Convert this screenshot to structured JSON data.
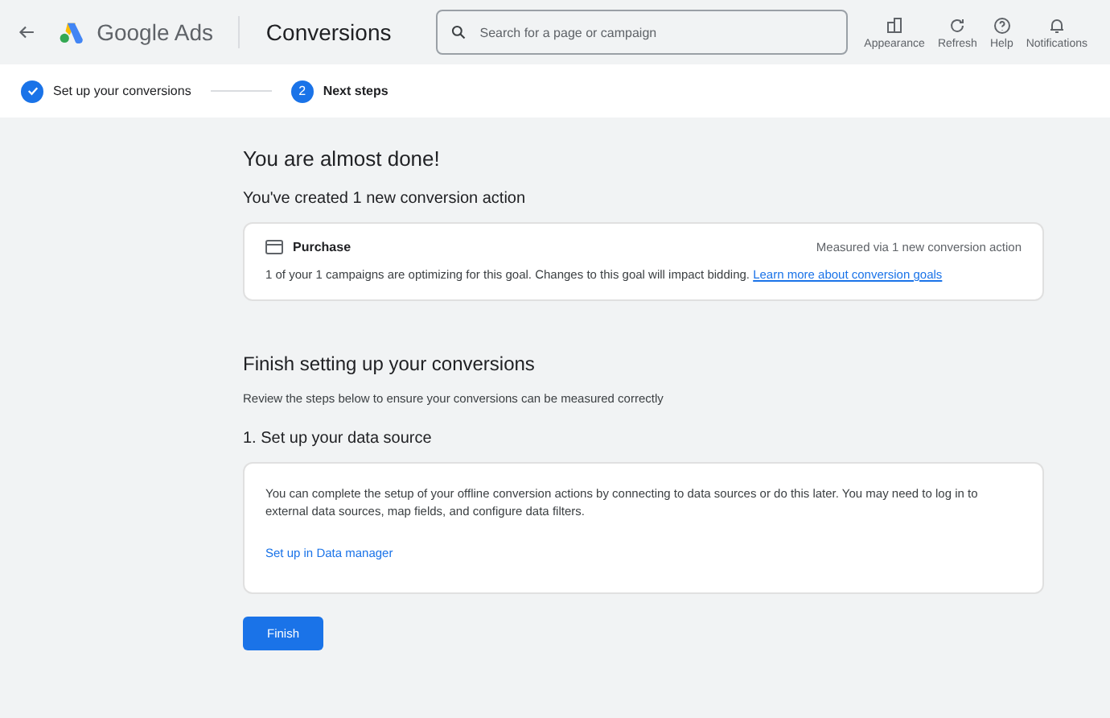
{
  "header": {
    "product": "Google Ads",
    "page_title": "Conversions",
    "search": {
      "placeholder": "Search for a page or campaign"
    },
    "actions": [
      {
        "kind": "appearance",
        "label": "Appearance"
      },
      {
        "kind": "refresh",
        "label": "Refresh"
      },
      {
        "kind": "help",
        "label": "Help"
      },
      {
        "kind": "notifications",
        "label": "Notifications"
      }
    ]
  },
  "stepper": [
    {
      "label": "Set up your conversions",
      "completed": true
    },
    {
      "number": "2",
      "label": "Next steps",
      "completed": false
    }
  ],
  "summary": {
    "title": "You are almost done!",
    "subtitle": "You've created 1 new conversion action",
    "goal": {
      "name": "Purchase",
      "measured": "Measured via 1 new conversion action",
      "description": "1 of your 1 campaigns are optimizing for this goal. Changes to this goal will impact bidding.",
      "link": "Learn more about conversion goals"
    }
  },
  "finish": {
    "title": "Finish setting up your conversions",
    "subtitle": "Review the steps below to ensure your conversions can be measured correctly",
    "step_title": "1. Set up your data source",
    "step_text": "You can complete the setup of your offline conversion actions by connecting to data sources or do this later. You may need to log in to external data sources, map fields, and configure data filters.",
    "step_link": "Set up in Data manager",
    "button": "Finish"
  }
}
